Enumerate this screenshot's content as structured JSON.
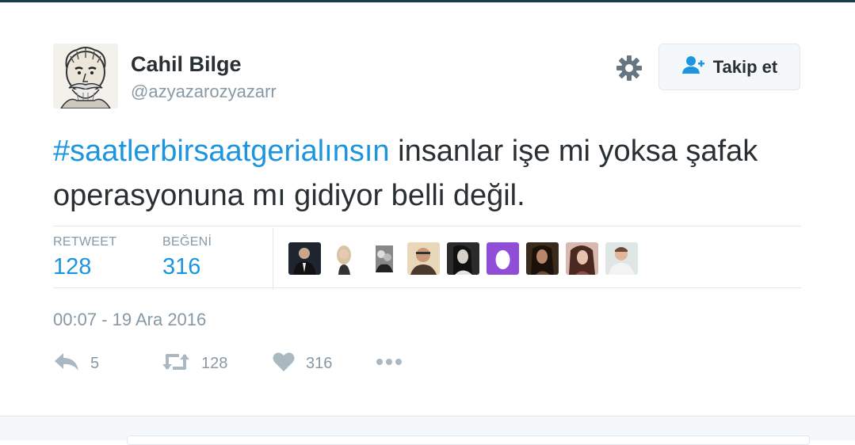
{
  "user": {
    "name": "Cahil Bilge",
    "handle": "@azyazarozyazarr"
  },
  "follow_button": {
    "label": "Takip et",
    "icon": "add-user-icon"
  },
  "settings": {
    "icon": "gear-icon"
  },
  "tweet": {
    "hashtag": "#saatlerbirsaatgerialınsın",
    "text": " insanlar işe mi yoksa şafak operasyonuna mı gidiyor belli değil."
  },
  "stats": {
    "retweet_label": "RETWEET",
    "retweet_count": "128",
    "like_label": "BEĞENİ",
    "like_count": "316"
  },
  "likers_count_shown": 9,
  "timestamp": "00:07 - 19 Ara 2016",
  "actions": {
    "reply_icon": "reply-icon",
    "reply_count": "5",
    "retweet_icon": "retweet-icon",
    "retweet_count": "128",
    "like_icon": "heart-icon",
    "like_count": "316",
    "more_icon": "more-icon"
  },
  "colors": {
    "link": "#1b95e0",
    "text": "#292f33",
    "muted": "#8899a6",
    "border": "#e1e8ed",
    "egg": "#8f4dd8"
  }
}
